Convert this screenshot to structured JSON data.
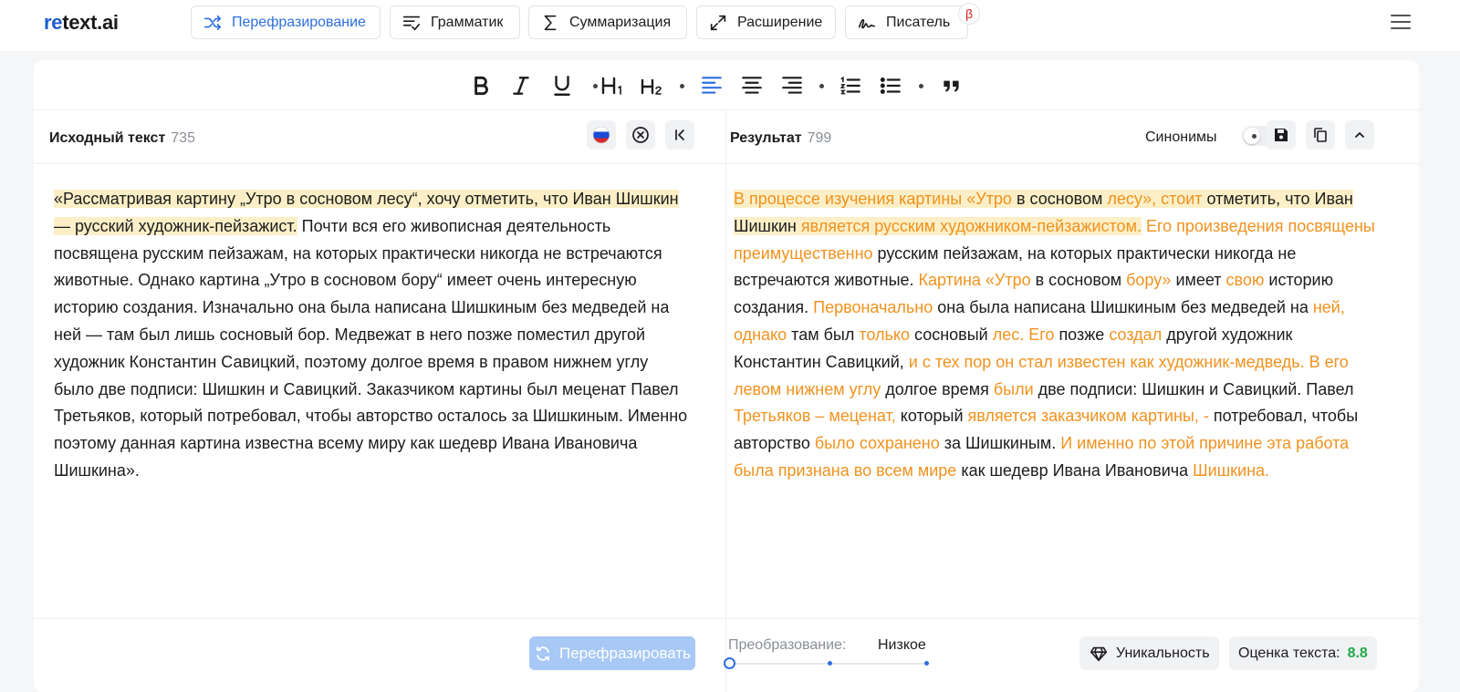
{
  "brand": {
    "logo_accent": "re",
    "logo_rest": "text.ai"
  },
  "nav": {
    "paraphrase": "Перефразирование",
    "grammar": "Грамматик",
    "summarize": "Суммаризация",
    "expand": "Расширение",
    "writer": "Писатель",
    "beta_badge": "β"
  },
  "colors": {
    "accent": "#2c6fe0",
    "changed_text": "#f0921e",
    "highlight": "#fcefc7",
    "score": "#21a84a"
  },
  "source": {
    "title": "Исходный текст",
    "count": "735",
    "highlighted": "«Рассматривая картину „Утро в сосновом лесу“, хочу отметить, что Иван Шишкин — русский художник-пейзажист.",
    "rest": " Почти вся его живописная деятельность посвящена русским пейзажам, на которых практически никогда не встречаются животные. Однако картина „Утро в сосновом бору“ имеет очень интересную историю создания. Изначально она была написана Шишкиным без медведей на ней — там был лишь сосновый бор. Медвежат в него позже поместил другой художник Константин Савицкий, поэтому долгое время в правом нижнем углу было две подписи: Шишкин и Савицкий. Заказчиком картины был меценат Павел Третьяков, который потребовал, чтобы авторство осталось за Шишкиным. Именно поэтому данная картина известна всему миру как шедевр Ивана Ивановича Шишкина»."
  },
  "result": {
    "title": "Результат",
    "count": "799",
    "synonyms_label": "Синонимы",
    "segments": [
      "В процессе изучения картины «Утро",
      " в сосновом ",
      "лесу», стоит",
      " отметить, что Иван Шишкин ",
      "является русским художником-пейзажистом.",
      " ",
      "Его произведения посвящены преимущественно",
      " русским пейзажам, на которых практически никогда не встречаются животные. ",
      "Картина «Утро",
      " в сосновом ",
      "бору»",
      " имеет ",
      "свою",
      " историю создания. ",
      "Первоначально",
      " она была написана Шишкиным без медведей на ",
      "ней, однако",
      " там был ",
      "только",
      " сосновый ",
      "лес. Его",
      " позже ",
      "создал",
      " другой художник Константин Савицкий, ",
      "и с тех пор он стал известен как художник-медведь. В его левом нижнем углу",
      " долгое время ",
      "были",
      " две подписи: Шишкин и Савицкий. Павел ",
      "Третьяков – меценат,",
      " который ",
      "является заказчиком картины, -",
      " потребовал, чтобы авторство ",
      "было сохранено",
      " за Шишкиным. ",
      "И именно по этой причине эта работа была признана во всем мире",
      " как шедевр Ивана Ивановича ",
      "Шишкина."
    ]
  },
  "bottom": {
    "rephrase_button": "Перефразировать",
    "transform_label": "Преобразование:",
    "transform_value": "Низкое",
    "transform_level": 0,
    "uniqueness_button": "Уникальность",
    "score_label": "Оценка текста:",
    "score_value": "8.8"
  }
}
